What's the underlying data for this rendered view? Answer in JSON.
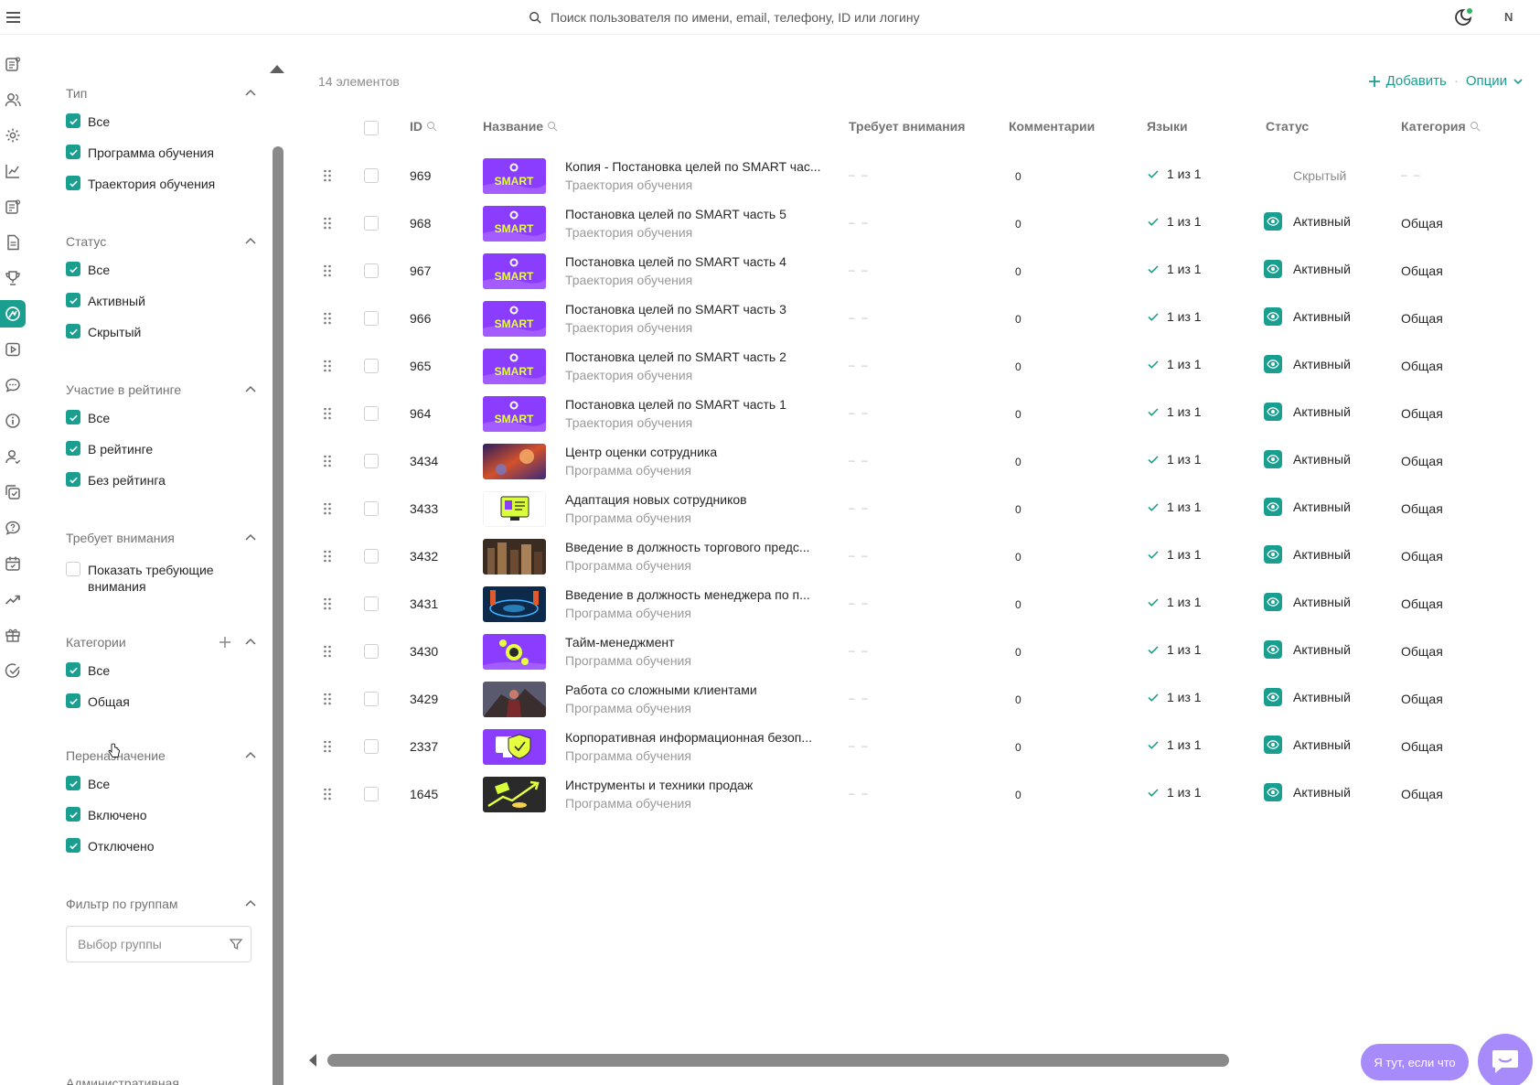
{
  "header": {
    "search_placeholder": "Поиск пользователя по имени, email, телефону, ID или логину",
    "user_initial": "N"
  },
  "colors": {
    "accent": "#1a9e8f",
    "help": "#a78bfa"
  },
  "rail": [
    "reports-icon",
    "users-icon",
    "settings-icon",
    "analytics-icon",
    "news-icon",
    "docs-icon",
    "trophy-icon",
    "learning-icon",
    "video-icon",
    "chat-icon",
    "info-icon",
    "profile-icon",
    "tasks-icon",
    "support-icon",
    "calendar-icon",
    "growth-icon",
    "gift-icon",
    "check-icon"
  ],
  "filters": {
    "type": {
      "title": "Тип",
      "options": [
        "Все",
        "Программа обучения",
        "Траектория обучения"
      ]
    },
    "status": {
      "title": "Статус",
      "options": [
        "Все",
        "Активный",
        "Скрытый"
      ]
    },
    "rating": {
      "title": "Участие в рейтинге",
      "options": [
        "Все",
        "В рейтинге",
        "Без рейтинга"
      ]
    },
    "attention": {
      "title": "Требует внимания",
      "option": "Показать требующие внимания"
    },
    "categories": {
      "title": "Категории",
      "options": [
        "Все",
        "Общая"
      ]
    },
    "reassign": {
      "title": "Переназначение",
      "options": [
        "Все",
        "Включено",
        "Отключено"
      ]
    },
    "groups": {
      "title": "Фильтр по группам",
      "placeholder": "Выбор группы"
    },
    "admin": {
      "title": "Административная"
    }
  },
  "toolbar": {
    "count": "14 элементов",
    "add_label": "Добавить",
    "dot": "·",
    "options_label": "Опции"
  },
  "columns": {
    "id": "ID",
    "name": "Название",
    "attention": "Требует внимания",
    "comments": "Комментарии",
    "languages": "Языки",
    "status": "Статус",
    "category": "Категория"
  },
  "rows": [
    {
      "id": "969",
      "title": "Копия - Постановка целей по SMART час...",
      "subtitle": "Траектория обучения",
      "attention": "– –",
      "comments": "0",
      "languages": "1 из 1",
      "status": "Скрытый",
      "category": "– –",
      "thumb": "smart"
    },
    {
      "id": "968",
      "title": "Постановка целей по SMART часть 5",
      "subtitle": "Траектория обучения",
      "attention": "– –",
      "comments": "0",
      "languages": "1 из 1",
      "status": "Активный",
      "category": "Общая",
      "thumb": "smart"
    },
    {
      "id": "967",
      "title": "Постановка целей по SMART часть 4",
      "subtitle": "Траектория обучения",
      "attention": "– –",
      "comments": "0",
      "languages": "1 из 1",
      "status": "Активный",
      "category": "Общая",
      "thumb": "smart"
    },
    {
      "id": "966",
      "title": "Постановка целей по SMART часть 3",
      "subtitle": "Траектория обучения",
      "attention": "– –",
      "comments": "0",
      "languages": "1 из 1",
      "status": "Активный",
      "category": "Общая",
      "thumb": "smart"
    },
    {
      "id": "965",
      "title": "Постановка целей по SMART часть 2",
      "subtitle": "Траектория обучения",
      "attention": "– –",
      "comments": "0",
      "languages": "1 из 1",
      "status": "Активный",
      "category": "Общая",
      "thumb": "smart"
    },
    {
      "id": "964",
      "title": "Постановка целей по SMART часть 1",
      "subtitle": "Траектория обучения",
      "attention": "– –",
      "comments": "0",
      "languages": "1 из 1",
      "status": "Активный",
      "category": "Общая",
      "thumb": "smart"
    },
    {
      "id": "3434",
      "title": "Центр оценки сотрудника",
      "subtitle": "Программа обучения",
      "attention": "– –",
      "comments": "0",
      "languages": "1 из 1",
      "status": "Активный",
      "category": "Общая",
      "thumb": "space"
    },
    {
      "id": "3433",
      "title": "Адаптация новых сотрудников",
      "subtitle": "Программа обучения",
      "attention": "– –",
      "comments": "0",
      "languages": "1 из 1",
      "status": "Активный",
      "category": "Общая",
      "thumb": "card"
    },
    {
      "id": "3432",
      "title": "Введение в должность торгового предс...",
      "subtitle": "Программа обучения",
      "attention": "– –",
      "comments": "0",
      "languages": "1 из 1",
      "status": "Активный",
      "category": "Общая",
      "thumb": "city"
    },
    {
      "id": "3431",
      "title": "Введение в должность менеджера по п...",
      "subtitle": "Программа обучения",
      "attention": "– –",
      "comments": "0",
      "languages": "1 из 1",
      "status": "Активный",
      "category": "Общая",
      "thumb": "tech"
    },
    {
      "id": "3430",
      "title": "Тайм-менеджмент",
      "subtitle": "Программа обучения",
      "attention": "– –",
      "comments": "0",
      "languages": "1 из 1",
      "status": "Активный",
      "category": "Общая",
      "thumb": "time"
    },
    {
      "id": "3429",
      "title": "Работа со сложными клиентами",
      "subtitle": "Программа обучения",
      "attention": "– –",
      "comments": "0",
      "languages": "1 из 1",
      "status": "Активный",
      "category": "Общая",
      "thumb": "warrior"
    },
    {
      "id": "2337",
      "title": "Корпоративная информационная безоп...",
      "subtitle": "Программа обучения",
      "attention": "– –",
      "comments": "0",
      "languages": "1 из 1",
      "status": "Активный",
      "category": "Общая",
      "thumb": "shield"
    },
    {
      "id": "1645",
      "title": "Инструменты и техники продаж",
      "subtitle": "Программа обучения",
      "attention": "– –",
      "comments": "0",
      "languages": "1 из 1",
      "status": "Активный",
      "category": "Общая",
      "thumb": "sales"
    }
  ],
  "thumb_text": {
    "smart": "SMART"
  },
  "help": {
    "pill": "Я тут, если что"
  }
}
